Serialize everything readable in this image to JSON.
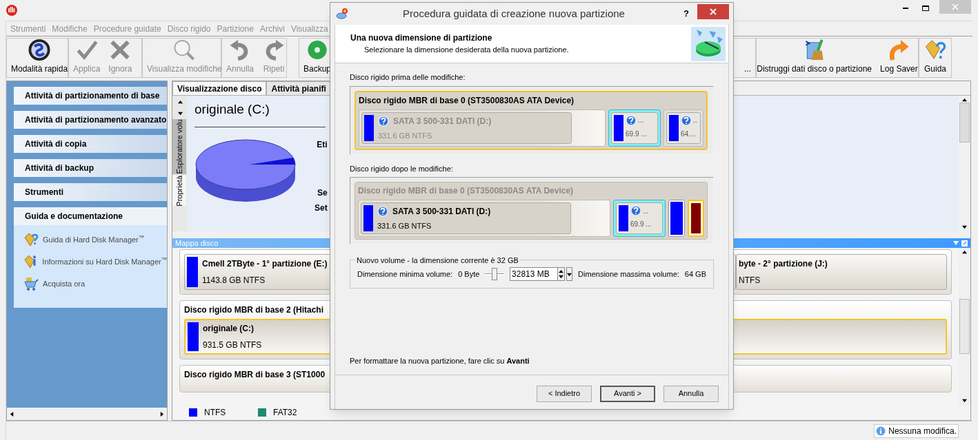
{
  "menu": [
    "Strumenti",
    "Modifiche",
    "Procedure guidate",
    "Disco rigido",
    "Partizione",
    "Archivi",
    "Visualizza"
  ],
  "toolbar": [
    [
      {
        "kind": "quick",
        "label": "Modalità rapida",
        "disabled": false
      }
    ],
    [
      {
        "kind": "apply",
        "label": "Applica",
        "disabled": true
      },
      {
        "kind": "discard",
        "label": "Ignora",
        "disabled": true
      }
    ],
    [
      {
        "kind": "view",
        "label": "Visualizza modifiche",
        "disabled": true
      }
    ],
    [
      {
        "kind": "undo",
        "label": "Annulla",
        "disabled": true
      },
      {
        "kind": "redo",
        "label": "Ripeti",
        "disabled": true
      }
    ],
    [
      {
        "kind": "backup",
        "label": "Backup",
        "disabled": false
      },
      {
        "kind": "more",
        "label": "...",
        "disabled": false
      }
    ],
    [
      {
        "kind": "wipe",
        "label": "Distruggi dati disco o partizione",
        "disabled": false
      },
      {
        "kind": "log",
        "label": "Log Saver",
        "disabled": false
      }
    ],
    [
      {
        "kind": "help",
        "label": "Guida",
        "disabled": false
      }
    ]
  ],
  "sidebar": {
    "sections": [
      {
        "label": "Attività di partizionamento di base",
        "expanded": false
      },
      {
        "label": "Attività di partizionamento avanzato",
        "expanded": false
      },
      {
        "label": "Attività di copia",
        "expanded": false
      },
      {
        "label": "Attività di backup",
        "expanded": false
      },
      {
        "label": "Strumenti",
        "expanded": false
      },
      {
        "label": "Guida e documentazione",
        "expanded": true,
        "items": [
          {
            "kind": "help",
            "label": "Guida di Hard Disk Manager$^{™}$"
          },
          {
            "kind": "info",
            "label": "Informazioni su Hard Disk Manager$^{™}$"
          },
          {
            "kind": "cart",
            "label": "Acquista ora"
          }
        ]
      }
    ]
  },
  "tabs": [
    {
      "label": "Visualizzazione disco",
      "selected": true
    },
    {
      "label": "Attività pianifi",
      "selected": false
    }
  ],
  "side_tabs": [
    {
      "label": "Esploratore volu",
      "selected": true
    },
    {
      "label": "Proprietà",
      "selected": false
    }
  ],
  "properties": {
    "title": "originale (C:)",
    "labels": [
      "Eti",
      "Se",
      "Set"
    ]
  },
  "disk_map": {
    "title": "Mappa disco",
    "disks": [
      {
        "partitions": [
          {
            "name": "Cmell 2TByte - 1° partizione (E:)",
            "size": "1143.8 GB NTFS",
            "selected": false
          },
          {
            "name": "byte - 2° partizione (J:)",
            "size": "NTFS",
            "selected": false
          }
        ]
      },
      {
        "title": "Disco rigido MBR di base 2 (Hitachi",
        "partitions": [
          {
            "name": "originale (C:)",
            "size": "931.5 GB NTFS",
            "selected": true
          }
        ]
      },
      {
        "title": "Disco rigido MBR di base 3 (ST1000"
      }
    ],
    "legend": [
      {
        "label": "NTFS",
        "color": "#0000ff"
      },
      {
        "label": "FAT32",
        "color": "#1f8a70"
      }
    ]
  },
  "status_bar": {
    "message": "Nessuna modifica."
  },
  "dialog": {
    "title": "Procedura guidata di creazione nuova partizione",
    "help": "?",
    "heading": "Una nuova dimensione di partizione",
    "subheading": "Selezionare la dimensione desiderata della nuova partizione.",
    "before": {
      "label": "Disco rigido prima delle modifiche:",
      "title": "Disco rigido MBR di base 0 (ST3500830AS ATA Device)",
      "title_greyed": false,
      "selected": true,
      "partitions": [
        {
          "kind": "full",
          "name": "SATA 3 500-331 DATI (D:)",
          "size": "331.6 GB NTFS",
          "greyed": true
        },
        {
          "kind": "small",
          "name": "...",
          "size": "69.9 ...",
          "selected": true
        },
        {
          "kind": "small",
          "name": "..",
          "size": "64....",
          "selected": false
        }
      ]
    },
    "after": {
      "label": "Disco rigido dopo le modifiche:",
      "title": "Disco rigido MBR di base 0 (ST3500830AS ATA Device)",
      "title_greyed": true,
      "selected": false,
      "partitions": [
        {
          "kind": "full",
          "name": "SATA 3 500-331 DATI (D:)",
          "size": "331.6 GB NTFS",
          "greyed": false
        },
        {
          "kind": "small",
          "name": "...",
          "size": "69.9 ...",
          "selected": true
        },
        {
          "kind": "bar",
          "color": "#0000ff",
          "focused": true,
          "selected": false
        },
        {
          "kind": "bar",
          "color": "#800000",
          "focused": false,
          "selected": true
        }
      ]
    },
    "volume": {
      "legend": "Nuovo volume - la dimensione corrente è 32 GB",
      "min_label": "Dimensione minima volume:",
      "min_value": "0 Byte",
      "level": 0.5,
      "size": "32813 MB",
      "max_label": "Dimensione massima volume:",
      "max_value": "64 GB"
    },
    "hint": "Per formattare la nuova partizione, fare clic su **Avanti**",
    "buttons": [
      {
        "label": "< Indietro",
        "default": false
      },
      {
        "label": "Avanti >",
        "default": true
      },
      {
        "label": "Annulla",
        "default": false
      }
    ]
  }
}
